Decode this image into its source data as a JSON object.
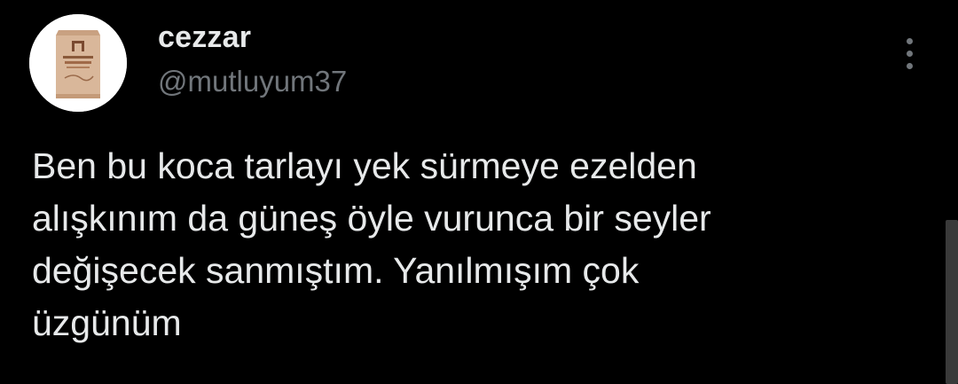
{
  "author": {
    "display_name": "cezzar",
    "handle": "@mutluyum37",
    "avatar_icon": "coffee-package-icon"
  },
  "tweet": {
    "lines": [
      "Ben bu koca tarlayı yek sürmeye ezelden",
      "alışkınım da güneş öyle vurunca bir seyler",
      "değişecek sanmıştım. Yanılmışım çok",
      "üzgünüm"
    ]
  },
  "menu": {
    "icon": "more-vertical-icon"
  },
  "colors": {
    "background": "#000000",
    "primary_text": "#e7e9ea",
    "secondary_text": "#71767b"
  }
}
